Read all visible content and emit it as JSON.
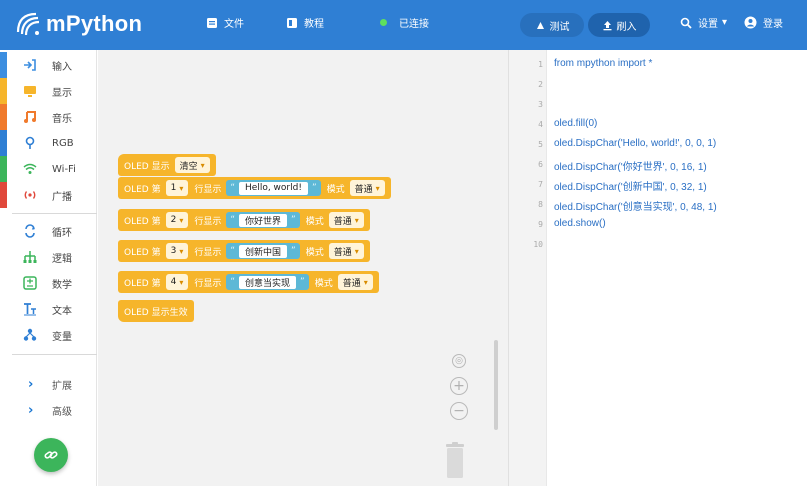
{
  "header": {
    "logo_text": "mPython",
    "menu": [
      {
        "label": "文件",
        "icon": "file-icon"
      },
      {
        "label": "教程",
        "icon": "book-icon"
      }
    ],
    "status": "已连接",
    "status_color": "#5ee05e",
    "actions": [
      {
        "label": "测试",
        "icon": "test-icon"
      },
      {
        "label": "刷入",
        "icon": "upload-icon"
      },
      {
        "label": "设置",
        "icon": "search-icon"
      },
      {
        "label": "登录",
        "icon": "user-icon"
      }
    ],
    "accent": "#2f7fd4"
  },
  "sidebar": {
    "categories": [
      {
        "label": "输入",
        "icon": "input-icon",
        "color": "#3c8ee0"
      },
      {
        "label": "显示",
        "icon": "display-icon",
        "color": "#f6b52b"
      },
      {
        "label": "音乐",
        "icon": "music-icon",
        "color": "#f07a2c"
      },
      {
        "label": "RGB",
        "icon": "rgb-icon",
        "color": "#2f7fd4"
      },
      {
        "label": "Wi-Fi",
        "icon": "wifi-icon",
        "color": "#3cb55b"
      },
      {
        "label": "广播",
        "icon": "broadcast-icon",
        "color": "#e0483b"
      },
      {
        "label": "循环",
        "icon": "loop-icon",
        "color": "#2f7fd4"
      },
      {
        "label": "逻辑",
        "icon": "logic-icon",
        "color": "#3cb55b"
      },
      {
        "label": "数学",
        "icon": "math-icon",
        "color": "#3cb55b"
      },
      {
        "label": "文本",
        "icon": "text-icon",
        "color": "#2f7fd4"
      },
      {
        "label": "变量",
        "icon": "variable-icon",
        "color": "#2f7fd4"
      }
    ],
    "expanders": [
      {
        "label": "扩展"
      },
      {
        "label": "高级"
      }
    ],
    "fab_icon": "link-icon"
  },
  "workspace": {
    "block_color": "#f6b52b",
    "string_color": "#5db8d6",
    "clear_block": {
      "prefix": "OLED 显示",
      "value": "清空"
    },
    "line_blocks": [
      {
        "prefix": "OLED 第",
        "line": "1",
        "middle": "行显示",
        "text": "Hello, world!",
        "mode_label": "模式",
        "mode": "普通"
      },
      {
        "prefix": "OLED 第",
        "line": "2",
        "middle": "行显示",
        "text": "你好世界",
        "mode_label": "模式",
        "mode": "普通"
      },
      {
        "prefix": "OLED 第",
        "line": "3",
        "middle": "行显示",
        "text": "创新中国",
        "mode_label": "模式",
        "mode": "普通"
      },
      {
        "prefix": "OLED 第",
        "line": "4",
        "middle": "行显示",
        "text": "创意当实现",
        "mode_label": "模式",
        "mode": "普通"
      }
    ],
    "show_block": "OLED 显示生效",
    "controls": [
      "recenter-icon",
      "zoom-in-icon",
      "zoom-out-icon",
      "trash-icon"
    ]
  },
  "editor": {
    "line_numbers": [
      "1",
      "2",
      "3",
      "4",
      "5",
      "6",
      "7",
      "8",
      "9",
      "10"
    ],
    "lines": [
      "from mpython import *",
      "",
      "",
      "oled.fill(0)",
      "oled.DispChar('Hello, world!', 0, 0, 1)",
      "oled.DispChar('你好世界', 0, 16, 1)",
      "oled.DispChar('创新中国', 0, 32, 1)",
      "oled.DispChar('创意当实现', 0, 48, 1)",
      "oled.show()",
      ""
    ]
  }
}
